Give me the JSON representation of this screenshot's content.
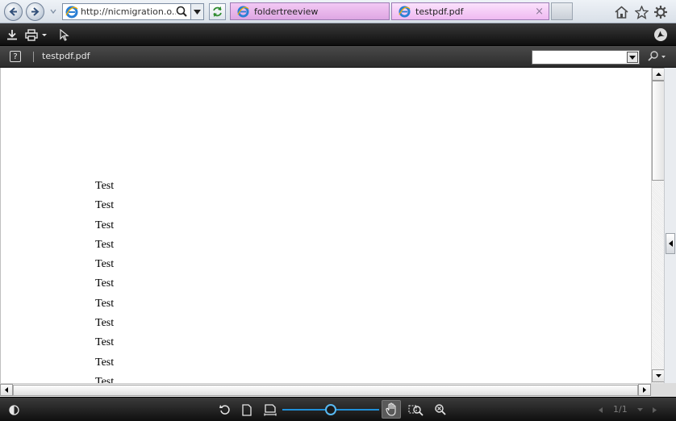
{
  "browser": {
    "address_url": "http://nicmigration.o...",
    "tabs": [
      {
        "label": "foldertreeview"
      },
      {
        "label": "testpdf.pdf",
        "close_glyph": "×"
      }
    ]
  },
  "viewer": {
    "help_glyph": "?",
    "filename": "testpdf.pdf",
    "search_placeholder": ""
  },
  "document": {
    "lines": [
      "Test",
      "Test",
      "Test",
      "Test",
      "Test",
      "Test",
      "Test",
      "Test",
      "Test",
      "Test",
      "Test"
    ]
  },
  "footer": {
    "page_indicator": "1/1",
    "zoom_fraction": 0.5
  },
  "icons": {
    "back": "back-arrow-icon",
    "forward": "forward-arrow-icon",
    "download": "download-icon",
    "print": "print-icon",
    "select": "select-tool-icon",
    "acrobat": "acrobat-icon",
    "home": "home-icon",
    "favorites": "star-icon",
    "tools": "gear-icon"
  },
  "colors": {
    "tab_active": "#dea6e3",
    "toolbar": "#1a1a1a",
    "slider": "#1f8fd8"
  }
}
